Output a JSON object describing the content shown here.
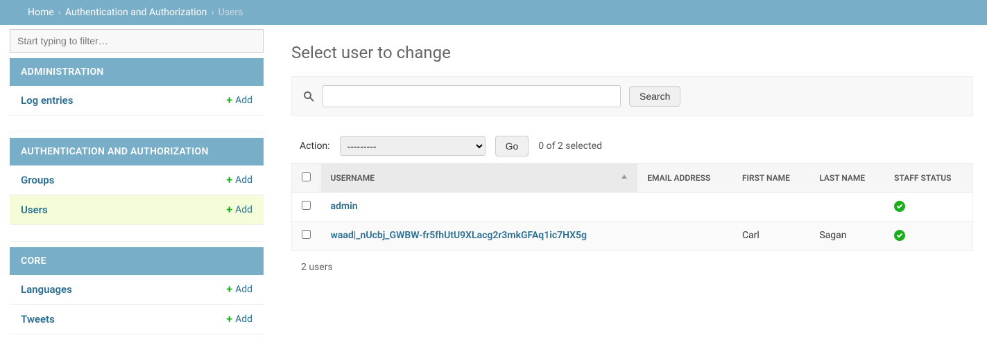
{
  "breadcrumb": {
    "home": "Home",
    "app": "Authentication and Authorization",
    "current": "Users"
  },
  "sidebar": {
    "filter_placeholder": "Start typing to filter…",
    "add_label": "Add",
    "sections": [
      {
        "caption": "ADMINISTRATION",
        "items": [
          {
            "name": "Log entries",
            "active": false
          }
        ]
      },
      {
        "caption": "AUTHENTICATION AND AUTHORIZATION",
        "items": [
          {
            "name": "Groups",
            "active": false
          },
          {
            "name": "Users",
            "active": true
          }
        ]
      },
      {
        "caption": "CORE",
        "items": [
          {
            "name": "Languages",
            "active": false
          },
          {
            "name": "Tweets",
            "active": false
          }
        ]
      }
    ]
  },
  "main": {
    "title": "Select user to change",
    "search_button": "Search",
    "action": {
      "label": "Action:",
      "selected_option": "---------",
      "go_label": "Go",
      "selected_text": "0 of 2 selected"
    },
    "columns": {
      "username": "USERNAME",
      "email": "EMAIL ADDRESS",
      "first_name": "FIRST NAME",
      "last_name": "LAST NAME",
      "staff_status": "STAFF STATUS"
    },
    "rows": [
      {
        "username": "admin",
        "email": "",
        "first_name": "",
        "last_name": "",
        "staff_status": true
      },
      {
        "username": "waad|_nUcbj_GWBW-fr5fhUtU9XLacg2r3mkGFAq1ic7HX5g",
        "email": "",
        "first_name": "Carl",
        "last_name": "Sagan",
        "staff_status": true
      }
    ],
    "row_count": "2 users"
  }
}
